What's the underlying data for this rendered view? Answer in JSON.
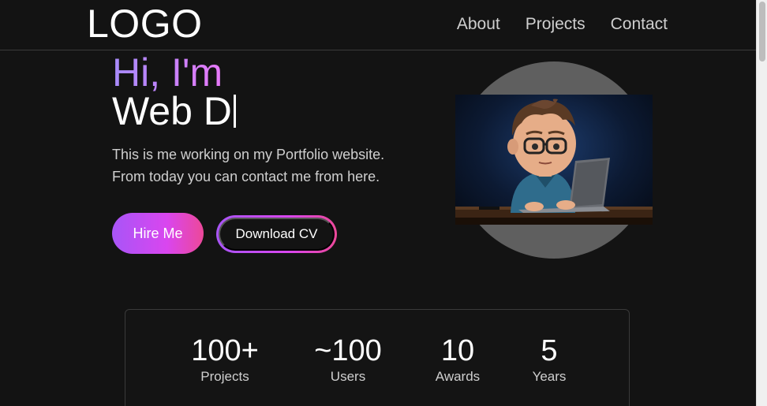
{
  "header": {
    "logo": "LOGO",
    "nav": [
      "About",
      "Projects",
      "Contact"
    ]
  },
  "hero": {
    "greeting": "Hi, I'm",
    "role_typed": "Web D",
    "description_line1": "This is me working on my Portfolio website.",
    "description_line2": "From today you can contact me from here.",
    "hire_button": "Hire Me",
    "cv_button": "Download CV"
  },
  "stats": [
    {
      "value": "100+",
      "label": "Projects"
    },
    {
      "value": "~100",
      "label": "Users"
    },
    {
      "value": "10",
      "label": "Awards"
    },
    {
      "value": "5",
      "label": "Years"
    }
  ],
  "colors": {
    "background": "#131313",
    "accent_start": "#a855f7",
    "accent_end": "#ec4899",
    "text_muted": "#cfcfcf"
  }
}
